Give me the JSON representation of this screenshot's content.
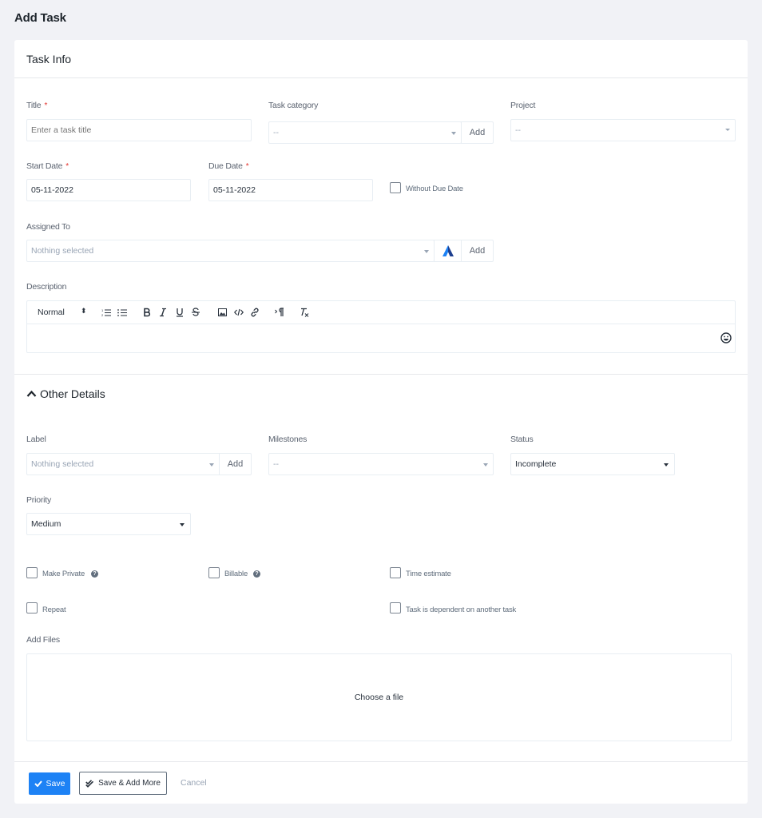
{
  "page": {
    "title": "Add Task"
  },
  "task_info": {
    "heading": "Task Info",
    "title_field": {
      "label": "Title",
      "required_mark": "*",
      "placeholder": "Enter a task title"
    },
    "category": {
      "label": "Task category",
      "value": "--",
      "add_label": "Add"
    },
    "project": {
      "label": "Project",
      "value": "--"
    },
    "start_date": {
      "label": "Start Date",
      "required_mark": "*",
      "value": "05-11-2022"
    },
    "due_date": {
      "label": "Due Date",
      "required_mark": "*",
      "value": "05-11-2022"
    },
    "without_due_date": {
      "label": "Without Due Date"
    },
    "assigned_to": {
      "label": "Assigned To",
      "value": "Nothing selected",
      "add_label": "Add"
    },
    "description": {
      "label": "Description",
      "toolbar": {
        "style_select": "Normal",
        "style_arrows": "⬍"
      }
    }
  },
  "other_details": {
    "heading": "Other Details",
    "label_field": {
      "label": "Label",
      "value": "Nothing selected",
      "add_label": "Add"
    },
    "milestones": {
      "label": "Milestones",
      "value": "--"
    },
    "status": {
      "label": "Status",
      "value": "Incomplete"
    },
    "priority": {
      "label": "Priority",
      "value": "Medium"
    },
    "make_private": {
      "label": "Make Private"
    },
    "billable": {
      "label": "Billable"
    },
    "time_estimate": {
      "label": "Time estimate"
    },
    "repeat": {
      "label": "Repeat"
    },
    "dependent": {
      "label": "Task is dependent on another task"
    },
    "add_files": {
      "label": "Add Files",
      "dropzone": "Choose a file"
    }
  },
  "footer": {
    "save": "Save",
    "save_add_more": "Save & Add More",
    "cancel": "Cancel"
  },
  "colors": {
    "primary": "#1d82f5",
    "background": "#f1f2f6",
    "required": "#e3342f",
    "text": "#28313c"
  }
}
